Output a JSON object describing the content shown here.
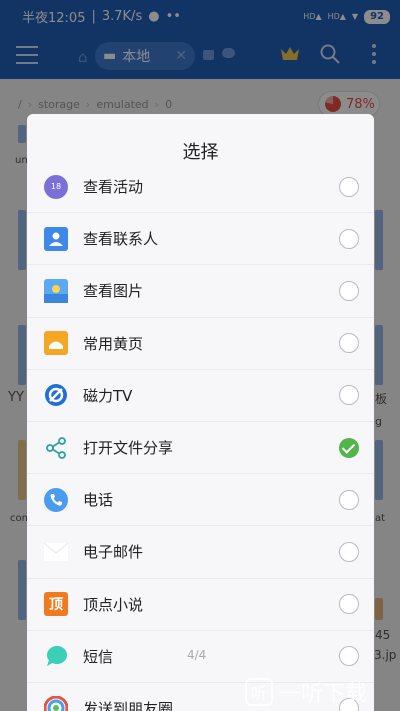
{
  "status_bar": {
    "time": "半夜12:05",
    "speed": "3.7K/s",
    "battery": "92"
  },
  "toolbar": {
    "tab_label": "本地"
  },
  "breadcrumb": {
    "root": "/",
    "items": [
      "storage",
      "emulated",
      "0"
    ],
    "storage_percent": "78%"
  },
  "background": {
    "texts": [
      "un",
      "YY",
      "com",
      "45",
      "3.jp",
      "板",
      "g",
      "at"
    ]
  },
  "dialog": {
    "title": "选择",
    "items": [
      {
        "label": "查看活动",
        "icon": "activity-icon",
        "checked": false
      },
      {
        "label": "查看联系人",
        "icon": "contacts-icon",
        "checked": false
      },
      {
        "label": "查看图片",
        "icon": "gallery-icon",
        "checked": false
      },
      {
        "label": "常用黄页",
        "icon": "yellow-pages-icon",
        "checked": false
      },
      {
        "label": "磁力TV",
        "icon": "tv-icon",
        "checked": false
      },
      {
        "label": "打开文件分享",
        "icon": "share-icon",
        "checked": true
      },
      {
        "label": "电话",
        "icon": "phone-icon",
        "checked": false
      },
      {
        "label": "电子邮件",
        "icon": "email-icon",
        "checked": false
      },
      {
        "label": "顶点小说",
        "icon": "novel-icon",
        "checked": false
      },
      {
        "label": "短信",
        "icon": "sms-icon",
        "checked": false
      },
      {
        "label": "发送到朋友圈",
        "icon": "moments-icon",
        "checked": false
      }
    ],
    "activity_icon_text": "18",
    "novel_icon_text": "顶",
    "page_indicator": "4/4"
  },
  "watermark": {
    "logo_text": "听",
    "text": "一听下载"
  },
  "colors": {
    "primary": "#1f5fb9",
    "checked": "#54b44c",
    "storage": "#e55040"
  }
}
